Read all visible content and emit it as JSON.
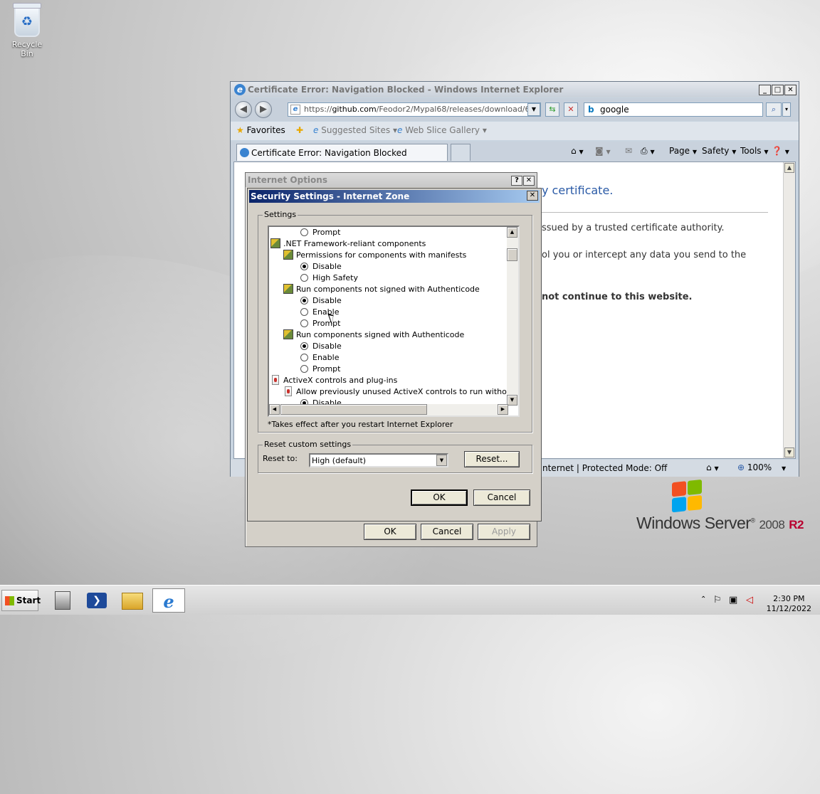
{
  "desktop": {
    "recycle_bin_label": "Recycle Bin",
    "logo_text": "Windows Server",
    "logo_version": "2008",
    "logo_r2": "R2"
  },
  "ie": {
    "title": "Certificate Error: Navigation Blocked - Windows Internet Explorer",
    "address_prefix": "https://",
    "address_host": "github.com",
    "address_path": "/Feodor2/Mypal68/releases/download/68.12.5",
    "search_value": "google",
    "favorites_label": "Favorites",
    "suggested_sites_label": "Suggested Sites",
    "web_slice_label": "Web Slice Gallery",
    "tab_label": "Certificate Error: Navigation Blocked",
    "page_menu": "Page",
    "safety_menu": "Safety",
    "tools_menu": "Tools",
    "content_title": "y certificate.",
    "content_line1": "ssued by a trusted certificate authority.",
    "content_line2": "ol you or intercept any data you send to the",
    "content_line3": "not continue to this website.",
    "status_text": "nternet | Protected Mode: Off",
    "zoom": "100%"
  },
  "internet_options": {
    "title": "Internet Options",
    "ok": "OK",
    "cancel": "Cancel",
    "apply": "Apply"
  },
  "security_settings": {
    "title": "Security Settings - Internet Zone",
    "settings_group": "Settings",
    "tree": [
      {
        "kind": "radio",
        "label": "Prompt",
        "checked": false
      },
      {
        "kind": "category",
        "label": ".NET Framework-reliant components"
      },
      {
        "kind": "sub",
        "label": "Permissions for components with manifests"
      },
      {
        "kind": "radio",
        "label": "Disable",
        "checked": true
      },
      {
        "kind": "radio",
        "label": "High Safety",
        "checked": false
      },
      {
        "kind": "sub",
        "label": "Run components not signed with Authenticode"
      },
      {
        "kind": "radio",
        "label": "Disable",
        "checked": true
      },
      {
        "kind": "radio",
        "label": "Enable",
        "checked": false
      },
      {
        "kind": "radio",
        "label": "Prompt",
        "checked": false
      },
      {
        "kind": "sub",
        "label": "Run components signed with Authenticode"
      },
      {
        "kind": "radio",
        "label": "Disable",
        "checked": true
      },
      {
        "kind": "radio",
        "label": "Enable",
        "checked": false
      },
      {
        "kind": "radio",
        "label": "Prompt",
        "checked": false
      },
      {
        "kind": "category-ax",
        "label": "ActiveX controls and plug-ins"
      },
      {
        "kind": "sub-ax",
        "label": "Allow previously unused ActiveX controls to run without prom"
      },
      {
        "kind": "radio",
        "label": "Disable",
        "checked": true
      }
    ],
    "footnote": "*Takes effect after you restart Internet Explorer",
    "reset_group": "Reset custom settings",
    "reset_to_label": "Reset to:",
    "reset_select_value": "High (default)",
    "reset_button": "Reset...",
    "ok": "OK",
    "cancel": "Cancel"
  },
  "taskbar": {
    "start_label": "Start",
    "time": "2:30 PM",
    "date": "11/12/2022"
  }
}
